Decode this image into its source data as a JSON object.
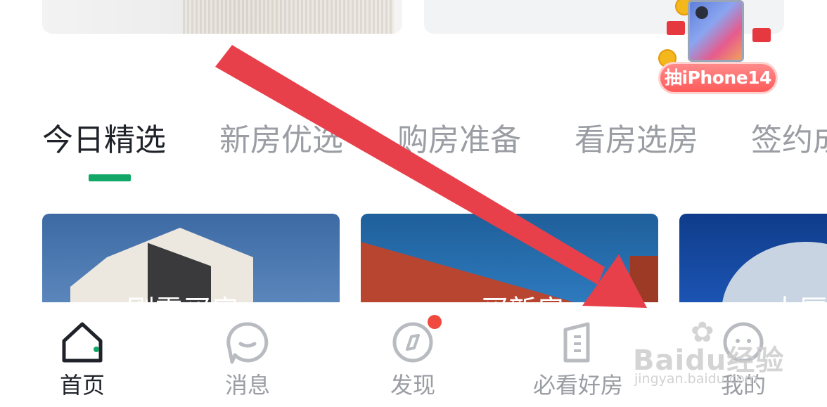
{
  "promo": {
    "badge_text": "抽iPhone14"
  },
  "tabs": [
    {
      "label": "今日精选",
      "active": true
    },
    {
      "label": "新房优选",
      "active": false
    },
    {
      "label": "购房准备",
      "active": false
    },
    {
      "label": "看房选房",
      "active": false
    },
    {
      "label": "签约成",
      "active": false
    }
  ],
  "cards": [
    {
      "title": "刚需买房"
    },
    {
      "title": "买新房"
    },
    {
      "title": "大厦"
    }
  ],
  "bottom_nav": [
    {
      "label": "首页",
      "icon": "home-icon",
      "active": true
    },
    {
      "label": "消息",
      "icon": "message-icon",
      "active": false
    },
    {
      "label": "发现",
      "icon": "discover-icon",
      "active": false,
      "badge": true
    },
    {
      "label": "必看好房",
      "icon": "building-icon",
      "active": false
    },
    {
      "label": "我的",
      "icon": "profile-icon",
      "active": false
    }
  ],
  "colors": {
    "accent": "#11a766",
    "arrow": "#e8404a",
    "badge_dot": "#f04a3e",
    "text_active": "#1f2329",
    "text_inactive": "#9a9da3"
  },
  "watermark": {
    "logo": "Baidu经验",
    "url": "jingyan.baidu.com"
  }
}
